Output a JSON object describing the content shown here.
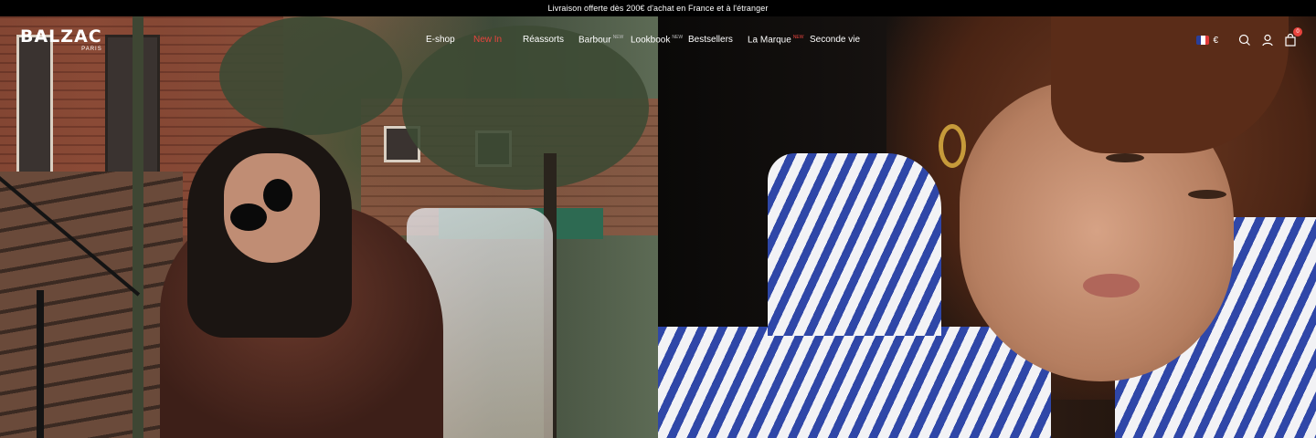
{
  "announcement": {
    "text": "Livraison offerte dès 200€ d'achat en France et à l'étranger"
  },
  "brand": {
    "name": "BALZAC",
    "city": "PARIS"
  },
  "nav": {
    "items": [
      {
        "label": "E-shop",
        "tag": ""
      },
      {
        "label": "New In",
        "tag": ""
      },
      {
        "label": "Réassorts",
        "tag": ""
      },
      {
        "label": "Barbour",
        "tag": "NEW"
      },
      {
        "label": "Lookbook",
        "tag": "NEW"
      },
      {
        "label": "Bestsellers",
        "tag": ""
      },
      {
        "label": "La Marque",
        "tag": "NEW"
      },
      {
        "label": "Seconde vie",
        "tag": ""
      }
    ]
  },
  "tools": {
    "currency": "€",
    "flag_icon": "france-flag-icon",
    "search_icon": "search-icon",
    "account_icon": "user-icon",
    "cart_icon": "shopping-bag-icon",
    "cart_count": "0"
  },
  "colors": {
    "accent": "#e8443e",
    "bar": "#000000",
    "text": "#ffffff"
  }
}
